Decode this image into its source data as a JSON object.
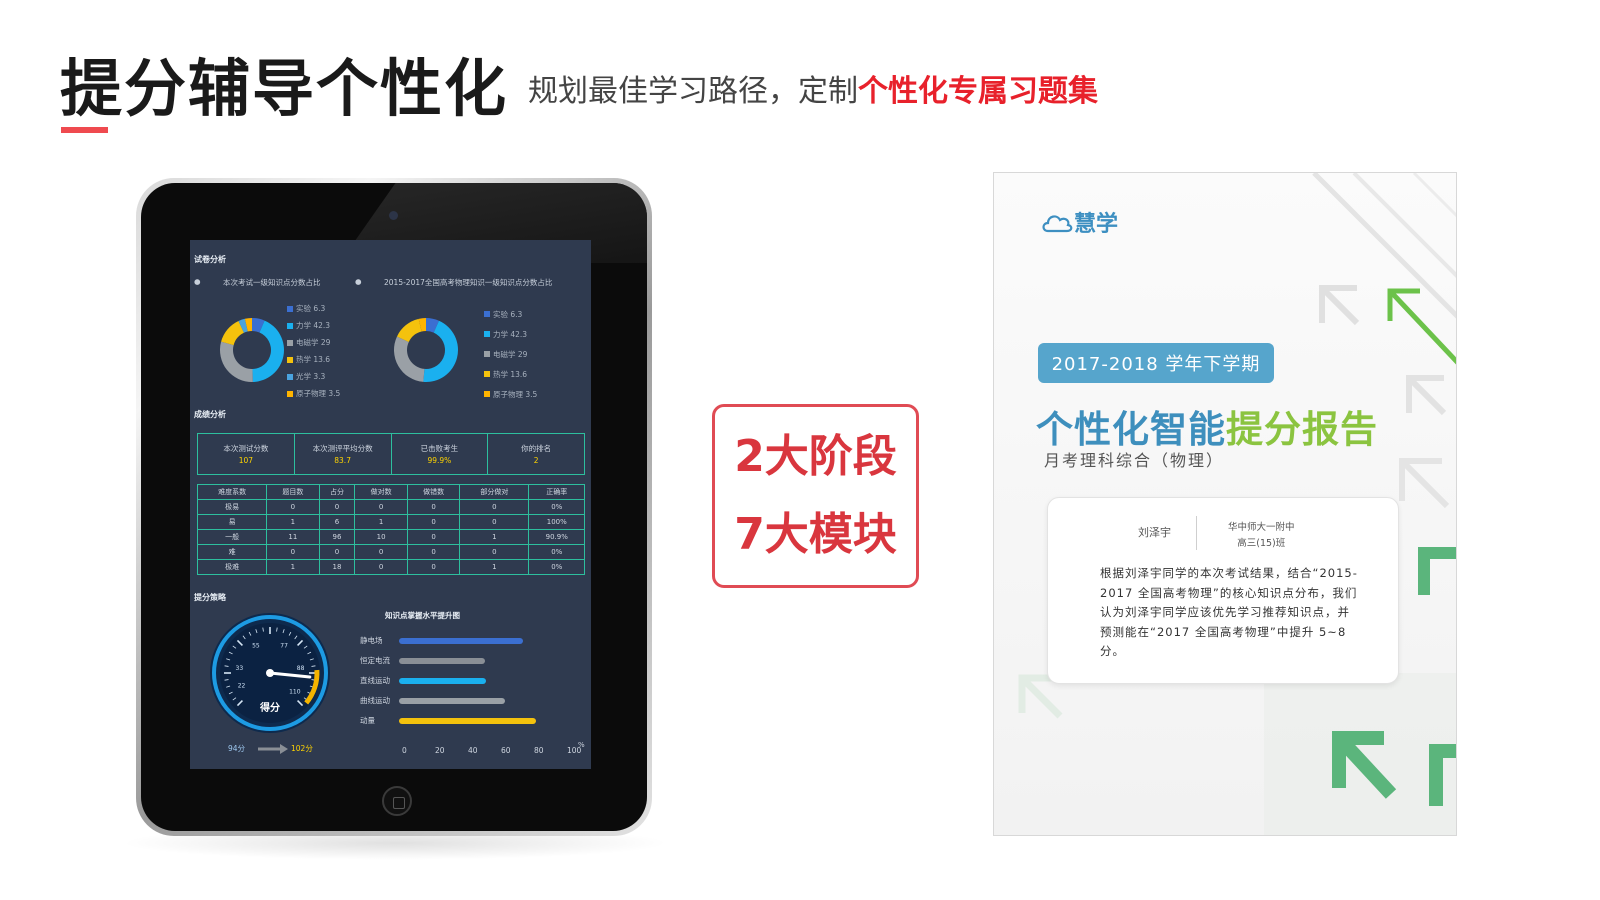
{
  "header": {
    "title": "提分辅导个性化",
    "subtitle_plain": "规划最佳学习路径，定制",
    "subtitle_highlight": "个性化专属习题集",
    "accent_color": "#e8212b"
  },
  "dashboard": {
    "section1_title": "试卷分析",
    "pie_left_title": "本次考试一级知识点分数占比",
    "pie_right_title": "2015-2017全国高考物理知识一级知识点分数占比",
    "pie_left_legend": [
      {
        "label": "实验 6.3",
        "color": "#3b6fd1",
        "value": 6.3
      },
      {
        "label": "力学 42.3",
        "color": "#1ab0ef",
        "value": 42.3
      },
      {
        "label": "电磁学 29",
        "color": "#9aa0a6",
        "value": 29
      },
      {
        "label": "热学 13.6",
        "color": "#f4c20d",
        "value": 13.6
      },
      {
        "label": "光学 3.3",
        "color": "#4aa3df",
        "value": 3.3
      },
      {
        "label": "原子物理 3.5",
        "color": "#ffb400",
        "value": 3.5
      }
    ],
    "pie_right_legend": [
      {
        "label": "实验 6.3",
        "color": "#3b6fd1",
        "value": 6.3
      },
      {
        "label": "力学 42.3",
        "color": "#1ab0ef",
        "value": 42.3
      },
      {
        "label": "电磁学 29",
        "color": "#9aa0a6",
        "value": 29
      },
      {
        "label": "热学 13.6",
        "color": "#f4c20d",
        "value": 13.6
      },
      {
        "label": "原子物理 3.5",
        "color": "#ffb400",
        "value": 3.5
      }
    ],
    "section2_title": "成绩分析",
    "stats": [
      {
        "label": "本次测试分数",
        "value": "107"
      },
      {
        "label": "本次测评平均分数",
        "value": "83.7"
      },
      {
        "label": "已击败考生",
        "value": "99.9%"
      },
      {
        "label": "你的排名",
        "value": "2"
      }
    ],
    "table_headers": [
      "难度系数",
      "题目数",
      "占分",
      "做对数",
      "做错数",
      "部分做对",
      "正确率"
    ],
    "table_rows": [
      [
        "极易",
        "0",
        "0",
        "0",
        "0",
        "0",
        "0%"
      ],
      [
        "易",
        "1",
        "6",
        "1",
        "0",
        "0",
        "100%"
      ],
      [
        "一般",
        "11",
        "96",
        "10",
        "0",
        "1",
        "90.9%"
      ],
      [
        "难",
        "0",
        "0",
        "0",
        "0",
        "0",
        "0%"
      ],
      [
        "极难",
        "1",
        "18",
        "0",
        "0",
        "1",
        "0%"
      ]
    ],
    "section3_title": "提分策略",
    "gauge_label": "得分",
    "gauge_ticks": [
      "33",
      "55",
      "77",
      "22",
      "88",
      "110"
    ],
    "gauge_value": 94,
    "score_from": "94分",
    "score_to": "102分",
    "bar_chart_title": "知识点掌握水平提升图",
    "bars": [
      {
        "label": "静电场",
        "value": 75,
        "color": "#3b6fd1"
      },
      {
        "label": "恒定电流",
        "value": 52,
        "color": "#8a8f96"
      },
      {
        "label": "直线运动",
        "value": 53,
        "color": "#1ab0ef"
      },
      {
        "label": "曲线运动",
        "value": 64,
        "color": "#9aa0a6"
      },
      {
        "label": "动量",
        "value": 83,
        "color": "#f4c20d"
      }
    ],
    "bar_axis": [
      "0",
      "20",
      "40",
      "60",
      "80",
      "100"
    ],
    "bar_axis_unit": "%"
  },
  "badge": {
    "line1": "2大阶段",
    "line2": "7大模块"
  },
  "report": {
    "logo_text": "慧学",
    "term": "2017-2018 学年下学期",
    "title_blue": "个性化智能",
    "title_green": "提分报告",
    "subtitle": "月考理科综合（物理）",
    "student_name": "刘泽宇",
    "school_line1": "华中师大一附中",
    "school_line2": "高三(15)班",
    "body": "根据刘泽宇同学的本次考试结果，结合“2015-2017 全国高考物理”的核心知识点分布，我们认为刘泽宇同学应该优先学习推荐知识点，并预测能在“2017 全国高考物理”中提升 5~8 分。"
  }
}
